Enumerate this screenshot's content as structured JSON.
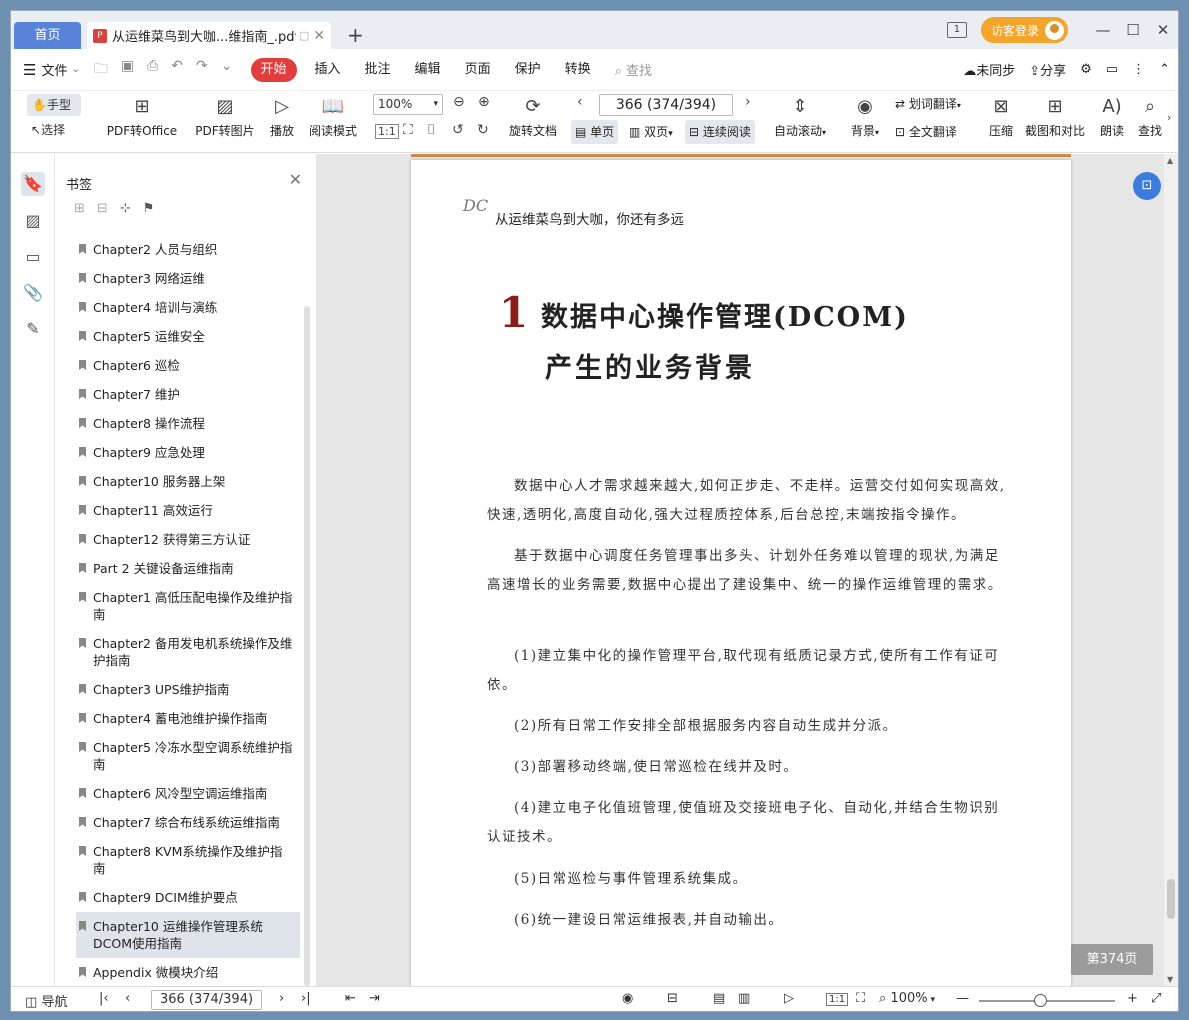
{
  "tabs": {
    "home": "首页",
    "doc_title": "从运维菜鸟到大咖...维指南_.pdf",
    "add": "+"
  },
  "window": {
    "login": "访客登录",
    "page_count_icon": "1",
    "min": "—",
    "max": "☐",
    "close": "✕"
  },
  "menu": {
    "file": "文件",
    "tabs": [
      "开始",
      "插入",
      "批注",
      "编辑",
      "页面",
      "保护",
      "转换"
    ],
    "active_tab": "开始",
    "search": "查找",
    "sync": "未同步",
    "share": "分享"
  },
  "toolbar": {
    "hand": "手型",
    "select": "选择",
    "pdf_to_office": "PDF转Office",
    "pdf_to_image": "PDF转图片",
    "play": "播放",
    "read_mode": "阅读模式",
    "zoom": "100%",
    "page_input": "366 (374/394)",
    "rotate": "旋转文档",
    "single": "单页",
    "double": "双页",
    "continuous": "连续阅读",
    "auto_scroll": "自动滚动",
    "background": "背景",
    "word_translate": "划词翻译",
    "full_translate": "全文翻译",
    "compress": "压缩",
    "screenshot_compare": "截图和对比",
    "read_aloud": "朗读",
    "find": "查找"
  },
  "bookmarks": {
    "title": "书签",
    "items": [
      "Chapter2 人员与组织",
      "Chapter3 网络运维",
      "Chapter4 培训与演练",
      "Chapter5 运维安全",
      "Chapter6 巡检",
      "Chapter7 维护",
      "Chapter8 操作流程",
      "Chapter9 应急处理",
      "Chapter10 服务器上架",
      "Chapter11 高效运行",
      "Chapter12 获得第三方认证",
      "Part 2 关键设备运维指南",
      "Chapter1 高低压配电操作及维护指南",
      "Chapter2 备用发电机系统操作及维护指南",
      "Chapter3 UPS维护指南",
      "Chapter4 蓄电池维护操作指南",
      "Chapter5 冷冻水型空调系统维护指南",
      "Chapter6 风冷型空调运维指南",
      "Chapter7 综合布线系统运维指南",
      "Chapter8 KVM系统操作及维护指南",
      "Chapter9 DCIM维护要点",
      "Chapter10 运维操作管理系统DCOM使用指南",
      "Appendix 微模块介绍"
    ],
    "selected_index": 21
  },
  "page": {
    "logo": "DC",
    "header": "从运维菜鸟到大咖，你还有多远",
    "chapter_num": "1",
    "title_line1": "数据中心操作管理(DCOM)",
    "title_line2": "产生的业务背景",
    "paragraphs": [
      "数据中心人才需求越来越大,如何正步走、不走样。运营交付如何实现高效,快速,透明化,高度自动化,强大过程质控体系,后台总控,末端按指令操作。",
      "基于数据中心调度任务管理事出多头、计划外任务难以管理的现状,为满足高速增长的业务需要,数据中心提出了建设集中、统一的操作运维管理的需求。",
      "(1)建立集中化的操作管理平台,取代现有纸质记录方式,使所有工作有证可依。",
      "(2)所有日常工作安排全部根据服务内容自动生成并分派。",
      "(3)部署移动终端,使日常巡检在线并及时。",
      "(4)建立电子化值班管理,使值班及交接班电子化、自动化,并结合生物识别认证技术。",
      "(5)日常巡检与事件管理系统集成。",
      "(6)统一建设日常运维报表,并自动输出。"
    ],
    "page_badge": "第374页"
  },
  "status": {
    "nav": "导航",
    "page_input": "366 (374/394)",
    "zoom": "100%",
    "zoom_level": 0.45
  }
}
